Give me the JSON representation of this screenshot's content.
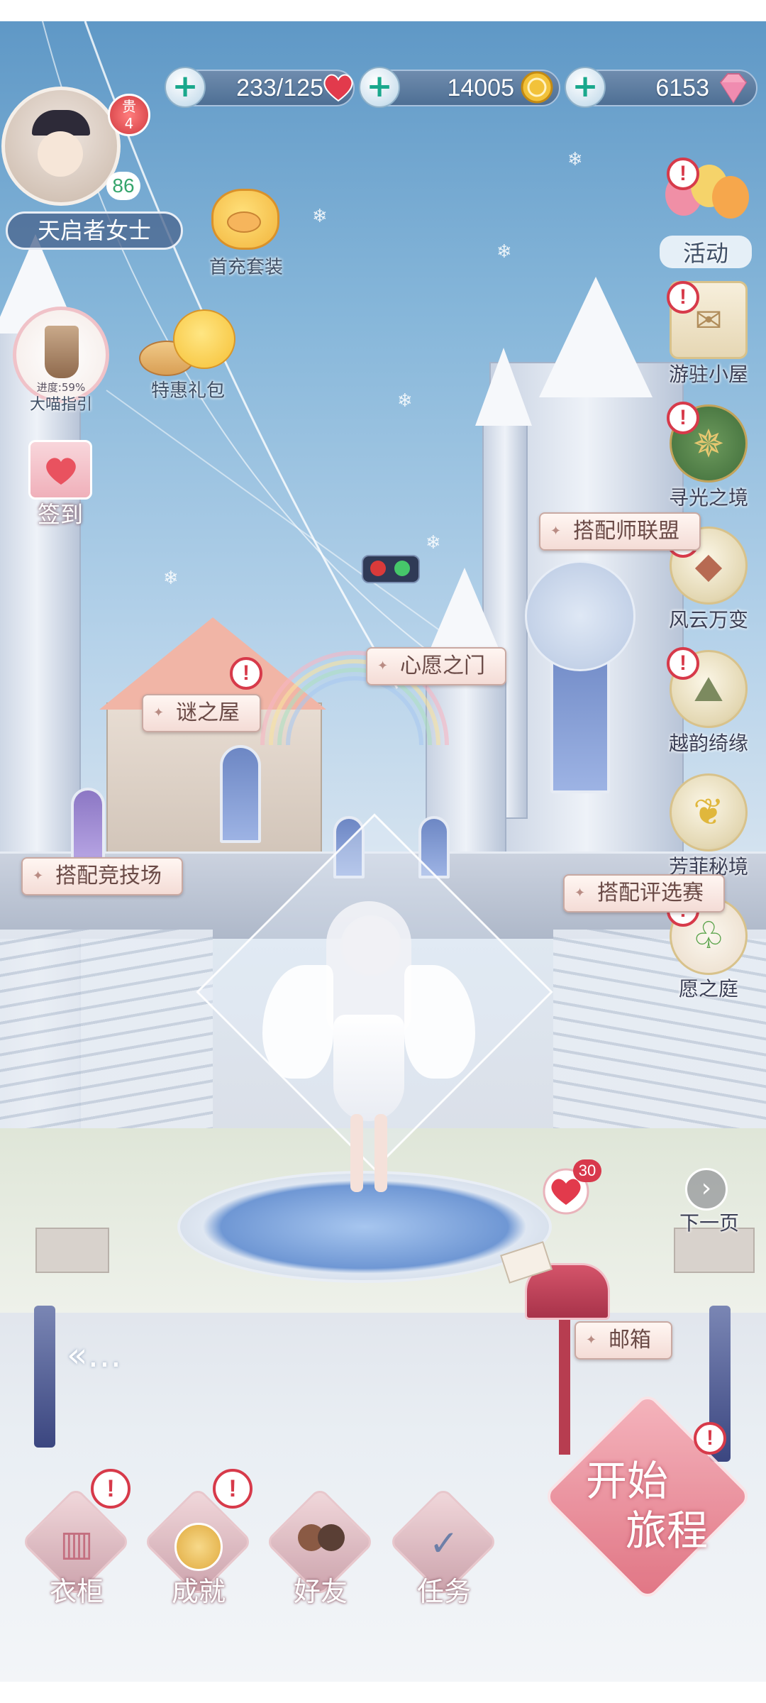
{
  "player": {
    "name": "天启者女士",
    "vip_label": "贵",
    "vip_level": "4",
    "level": "86"
  },
  "resources": {
    "stamina": "233/125",
    "coins": "14005",
    "gems": "6153"
  },
  "left_menu": {
    "first_charge": "首充套装",
    "special_pack": "特惠礼包",
    "guide_progress": "进度:59%",
    "guide_label": "大喵指引",
    "checkin": "签到"
  },
  "right_menu": [
    {
      "label": "活动",
      "icon": "balloon-icon"
    },
    {
      "label": "游驻小屋",
      "icon": "cabin-letter-icon"
    },
    {
      "label": "寻光之境",
      "icon": "compass-icon"
    },
    {
      "label": "风云万变",
      "icon": "kite-icon"
    },
    {
      "label": "越韵绮缘",
      "icon": "landscape-icon"
    },
    {
      "label": "芳菲秘境",
      "icon": "butterfly-icon"
    },
    {
      "label": "愿之庭",
      "icon": "sprout-icon"
    }
  ],
  "signs": {
    "stylist_union": "搭配师联盟",
    "wish_gate": "心愿之门",
    "mystery_house": "谜之屋",
    "arena": "搭配竞技场",
    "competition": "搭配评选赛",
    "mailbox": "邮箱"
  },
  "mailbox": {
    "count": "30"
  },
  "next_page": "下一页",
  "prev_arrows": "«…",
  "start_journey": {
    "line1": "开始",
    "line2": "旅程"
  },
  "bottom_nav": [
    {
      "label": "衣柜",
      "icon": "wardrobe-icon"
    },
    {
      "label": "成就",
      "icon": "achievement-medal-icon"
    },
    {
      "label": "好友",
      "icon": "friends-icon"
    },
    {
      "label": "任务",
      "icon": "task-checklist-icon"
    }
  ],
  "alert_mark": "!",
  "colors": {
    "sky_top": "#5f98c6",
    "alert_red": "#d73a4a",
    "sign_bg": "#f4dcd6",
    "start_button": "#e57c88",
    "heart": "#e23a4c",
    "coin_gold": "#f2c23a"
  }
}
